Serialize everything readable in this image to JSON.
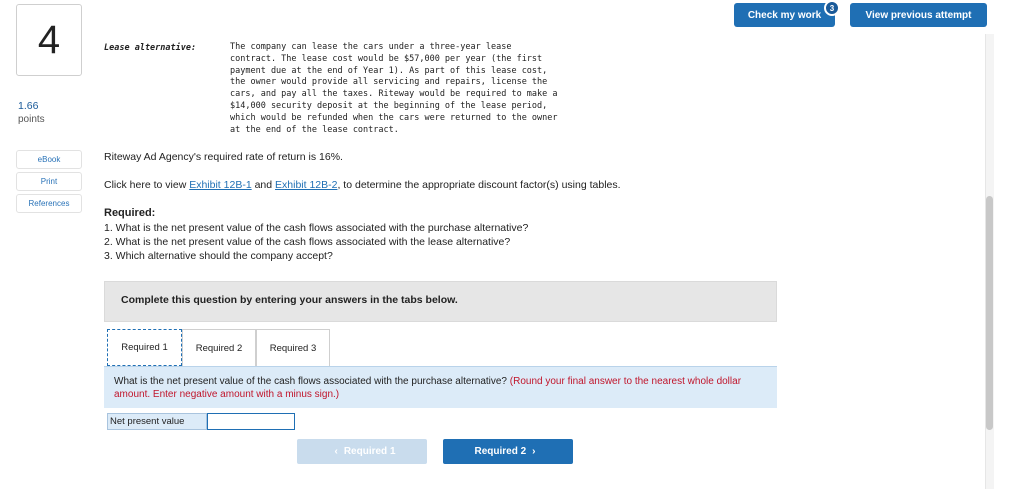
{
  "question": {
    "number": "4",
    "points_value": "1.66",
    "points_label": "points"
  },
  "side_links": [
    "eBook",
    "Print",
    "References"
  ],
  "header": {
    "check_label": "Check my work",
    "check_badge": "3",
    "prev_label": "View previous attempt"
  },
  "lease": {
    "label": "Lease alternative:",
    "lines": [
      "The company can lease the cars under a three-year lease",
      "contract. The lease cost would be $57,000 per year (the first",
      "payment due at the end of Year 1). As part of this lease cost,",
      "the owner would provide all servicing and repairs, license the",
      "cars, and pay all the taxes. Riteway would be required to make a",
      "$14,000 security deposit at the beginning of the lease period,",
      "which would be refunded when the cars were returned to the owner",
      "at the end of the lease contract."
    ]
  },
  "rate_text": "Riteway Ad Agency's required rate of return is 16%.",
  "exhibit": {
    "prefix": "Click here to view ",
    "link1": "Exhibit 12B-1",
    "mid": " and ",
    "link2": "Exhibit 12B-2",
    "suffix": ", to determine the appropriate discount factor(s) using tables."
  },
  "required": {
    "heading": "Required:",
    "items": [
      "1. What is the net present value of the cash flows associated with the purchase alternative?",
      "2. What is the net present value of the cash flows associated with the lease alternative?",
      "3. Which alternative should the company accept?"
    ]
  },
  "complete_text": "Complete this question by entering your answers in the tabs below.",
  "tabs": [
    "Required 1",
    "Required 2",
    "Required 3"
  ],
  "active_tab": "Required 1",
  "panel": {
    "question": "What is the net present value of the cash flows associated with the purchase alternative?",
    "instruction": "(Round your final answer to the nearest whole dollar amount. Enter negative amount with a minus sign.)"
  },
  "answer": {
    "label": "Net present value",
    "value": ""
  },
  "nav": {
    "prev_label": "Required 1",
    "next_label": "Required 2"
  },
  "colors": {
    "accent": "#1f6fb4",
    "instruction_red": "#c0152b",
    "panel_bg": "#dcebf8"
  }
}
